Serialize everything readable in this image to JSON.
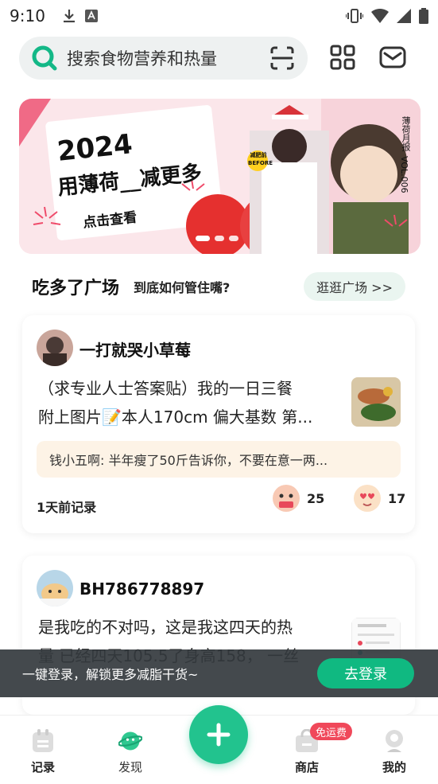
{
  "status_bar": {
    "time": "9:10"
  },
  "header": {
    "search_placeholder": "搜索食物营养和热量",
    "search_icon": "search-icon",
    "scan_icon": "scan-icon",
    "apps_icon": "grid-icon",
    "mail_icon": "mail-icon"
  },
  "banner": {
    "year": "2024",
    "headline": "用薄荷__减更多",
    "cta": "点击查看",
    "side_text": "薄荷月报",
    "vol": "VOL.006",
    "before_label": "减肥前",
    "before_en": "BEFORE",
    "slides": 3,
    "active_slide": 0
  },
  "section": {
    "title": "吃多了广场",
    "subtitle": "到底如何管住嘴?",
    "link": "逛逛广场 >>"
  },
  "posts": [
    {
      "author": "一打就哭小草莓",
      "line1": "（求专业人士答案贴）我的一日三餐",
      "line2": "附上图片📝本人170cm 偏大基数 第...",
      "comment": "钱小五啊: 半年瘦了50斤告诉你，不要在意一两...",
      "time": "1天前记录",
      "reactions": [
        {
          "icon": "envy-icon",
          "count": "25"
        },
        {
          "icon": "heart-eyes-icon",
          "count": "17"
        }
      ]
    },
    {
      "author": "BH786778897",
      "line1": "是我吃的不对吗，这是我这四天的热",
      "line2": "量 已经四天105.5了身高158， 一丝"
    }
  ],
  "login_bar": {
    "text": "一键登录，解锁更多减脂干货~",
    "button": "去登录"
  },
  "bottom_nav": {
    "items": [
      {
        "label": "记录",
        "icon": "record-icon"
      },
      {
        "label": "发现",
        "icon": "planet-icon"
      },
      {
        "label": "商店",
        "icon": "shop-icon"
      },
      {
        "label": "我的",
        "icon": "profile-icon"
      }
    ],
    "badge": "免运费",
    "fab_icon": "plus-icon"
  },
  "colors": {
    "primary": "#22c38e",
    "login_button": "#10b981",
    "badge": "#f0485a",
    "banner_bg": "#fbe9ec"
  }
}
